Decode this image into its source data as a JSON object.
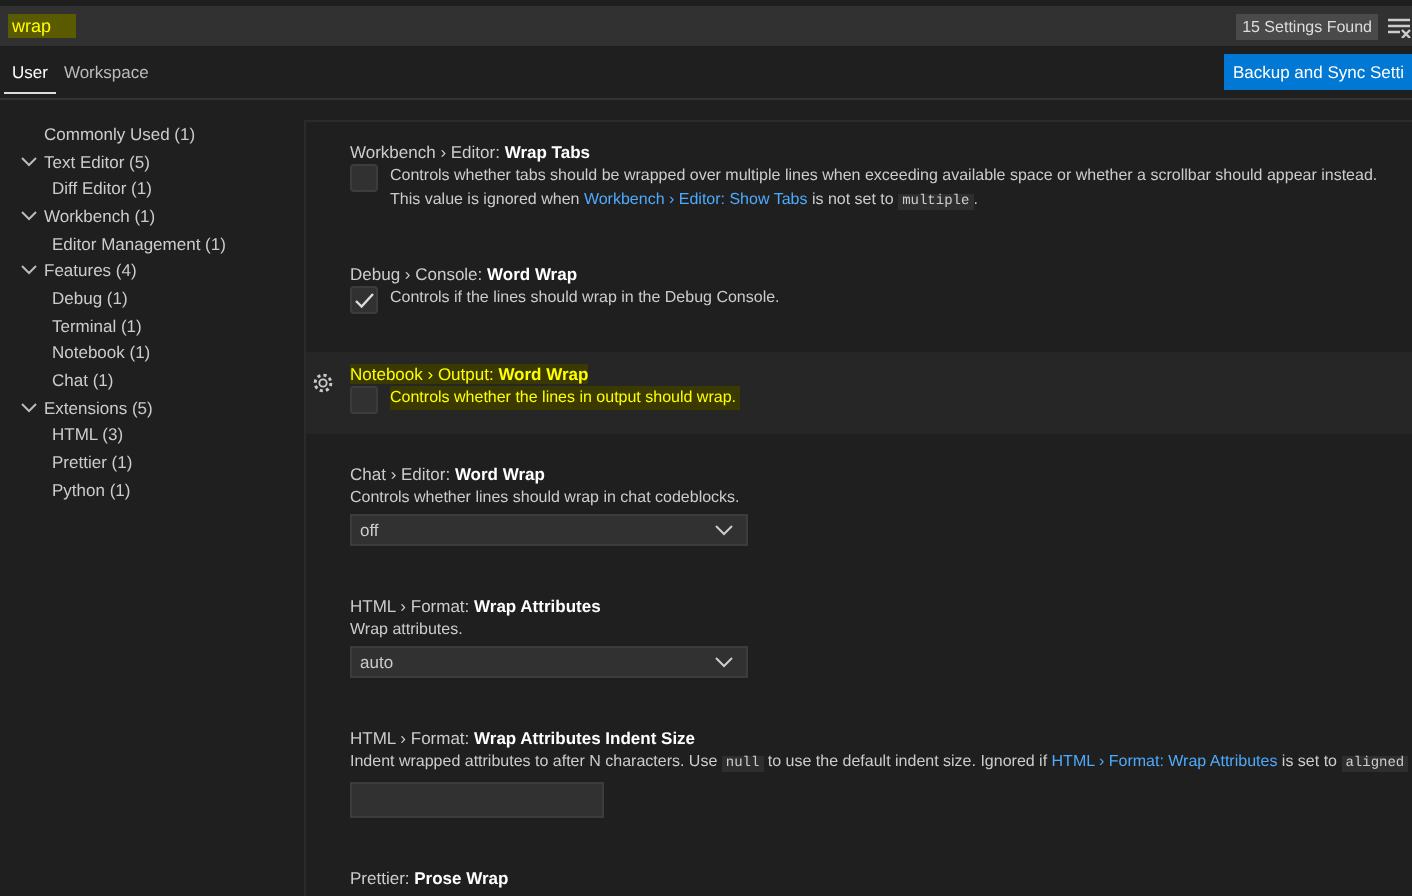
{
  "search": {
    "value": "wrap",
    "highlighted": true,
    "count": "15 Settings Found"
  },
  "tabs": [
    {
      "label": "User",
      "selected": true
    },
    {
      "label": "Workspace",
      "selected": false
    }
  ],
  "sync_button": "Backup and Sync Setti",
  "toc": [
    {
      "label": "Commonly Used (1)"
    },
    {
      "label": "Text Editor (5)",
      "expanded": true,
      "children": [
        {
          "label": "Diff Editor (1)"
        }
      ]
    },
    {
      "label": "Workbench (1)",
      "expanded": true,
      "children": [
        {
          "label": "Editor Management (1)"
        }
      ]
    },
    {
      "label": "Features (4)",
      "expanded": true,
      "children": [
        {
          "label": "Debug (1)"
        },
        {
          "label": "Terminal (1)"
        },
        {
          "label": "Notebook (1)"
        },
        {
          "label": "Chat (1)"
        }
      ]
    },
    {
      "label": "Extensions (5)",
      "expanded": true,
      "children": [
        {
          "label": "HTML (3)"
        },
        {
          "label": "Prettier (1)"
        },
        {
          "label": "Python (1)"
        }
      ]
    }
  ],
  "settings": [
    {
      "kind": "checkbox",
      "category": "Workbench › Editor: ",
      "name": "Wrap Tabs",
      "checked": false,
      "focused": false,
      "highlighted": false,
      "description": [
        {
          "kind": "text",
          "text": "Controls whether tabs should be wrapped over multiple lines when exceeding available space or whether a scrollbar should appear instead. This value is ignored when "
        },
        {
          "kind": "link",
          "text": "Workbench › Editor: Show Tabs"
        },
        {
          "kind": "text",
          "text": " is not set to "
        },
        {
          "kind": "code",
          "text": "multiple"
        },
        {
          "kind": "text",
          "text": "."
        }
      ]
    },
    {
      "kind": "checkbox",
      "category": "Debug › Console: ",
      "name": "Word Wrap",
      "checked": true,
      "focused": false,
      "highlighted": false,
      "description": [
        {
          "kind": "text",
          "text": "Controls if the lines should wrap in the Debug Console."
        }
      ]
    },
    {
      "kind": "checkbox",
      "category": "Notebook › Output: ",
      "name": "Word Wrap",
      "checked": false,
      "focused": true,
      "highlighted": true,
      "description": [
        {
          "kind": "text",
          "text": "Controls whether the lines in output should wrap."
        }
      ]
    },
    {
      "kind": "select",
      "category": "Chat › Editor: ",
      "name": "Word Wrap",
      "value": "off",
      "focused": false,
      "highlighted": false,
      "description": [
        {
          "kind": "text",
          "text": "Controls whether lines should wrap in chat codeblocks."
        }
      ]
    },
    {
      "kind": "select",
      "category": "HTML › Format: ",
      "name": "Wrap Attributes",
      "value": "auto",
      "focused": false,
      "highlighted": false,
      "description": [
        {
          "kind": "text",
          "text": "Wrap attributes."
        }
      ]
    },
    {
      "kind": "text",
      "category": "HTML › Format: ",
      "name": "Wrap Attributes Indent Size",
      "focused": false,
      "highlighted": false,
      "description": [
        {
          "kind": "text",
          "text": "Indent wrapped attributes to after N characters. Use "
        },
        {
          "kind": "code",
          "text": "null"
        },
        {
          "kind": "text",
          "text": " to use the default indent size. Ignored if "
        },
        {
          "kind": "link",
          "text": "HTML › Format: Wrap Attributes"
        },
        {
          "kind": "text",
          "text": " is set to "
        },
        {
          "kind": "code",
          "text": "aligned"
        }
      ]
    },
    {
      "kind": "title_only",
      "category": "Prettier: ",
      "name": "Prose Wrap",
      "focused": false,
      "highlighted": false
    }
  ]
}
